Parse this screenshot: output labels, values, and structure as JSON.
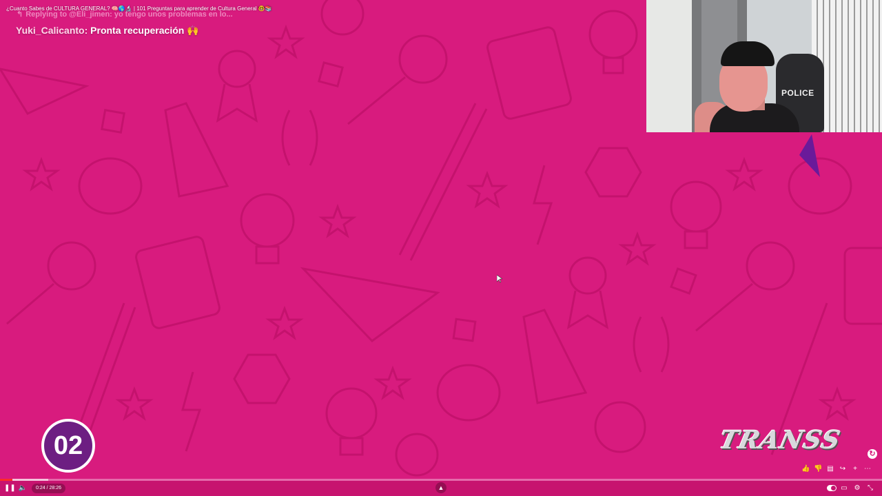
{
  "video": {
    "title": "¿Cuanto Sabes de CULTURA GENERAL? 🧠🌎🔬 | 101 Preguntas para aprender de Cultura General 🤓📚"
  },
  "chat": {
    "reply_prefix": "Replying to @Eli_jimen: yo tengo unos problemas en lo...",
    "username": "Yuki_Calicanto:",
    "message": "Pronta recuperación 🙌"
  },
  "webcam": {
    "chair_label": "POLICE"
  },
  "quiz": {
    "question_number": "02"
  },
  "logo": {
    "text": "TRANSS"
  },
  "player": {
    "time": "0:24 / 28:26",
    "progress_fraction": 0.014,
    "buffer_fraction": 0.055,
    "play_icon": "pause-icon",
    "volume_icon": "volume-icon",
    "expand_icon": "chevron-up-icon"
  },
  "right_actions": [
    "like-icon",
    "dislike-icon",
    "comment-icon",
    "share-icon",
    "plus-icon",
    "more-icon"
  ],
  "colors": {
    "background": "#d81b7e",
    "badge": "#6d1e82",
    "progress": "#ff2a2a"
  }
}
